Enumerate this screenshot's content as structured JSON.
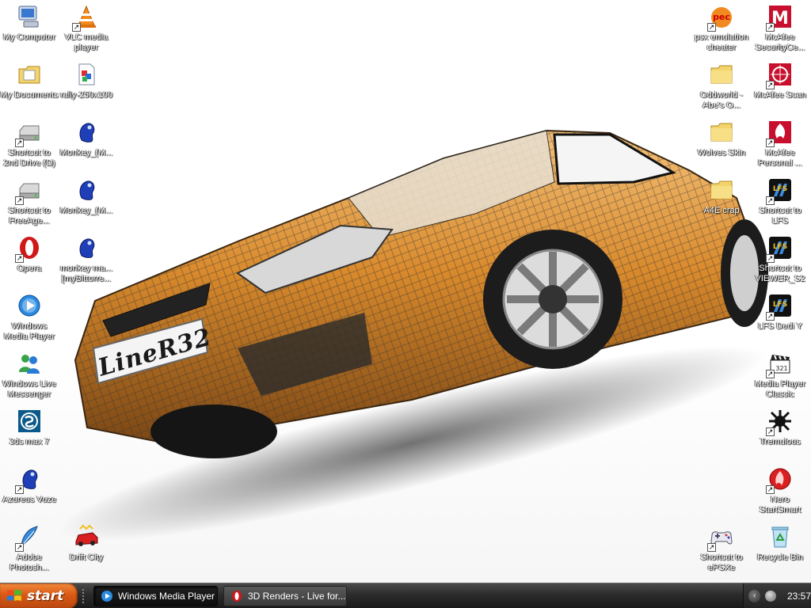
{
  "desktop": {
    "wallpaper": {
      "plate_text": "LineR32",
      "colors": {
        "car_body": "#d98a2c",
        "car_dark": "#5a3a18",
        "wire": "#3a3a3a"
      }
    },
    "icons": [
      {
        "id": "my-computer",
        "label": "My Computer",
        "icon": "computer-icon",
        "shortcut": false
      },
      {
        "id": "vlc",
        "label": "VLC media player",
        "icon": "vlc-cone-icon",
        "shortcut": true
      },
      {
        "id": "my-documents",
        "label": "My Documents",
        "icon": "documents-folder-icon",
        "shortcut": false
      },
      {
        "id": "rally",
        "label": "rally-250x100",
        "icon": "image-file-icon",
        "shortcut": false
      },
      {
        "id": "shortcut-drive-d",
        "label": "Shortcut to 2nd Drive (D)",
        "icon": "drive-icon",
        "shortcut": true
      },
      {
        "id": "monkey-1",
        "label": "Monkey_(M...",
        "icon": "azureus-frog-icon",
        "shortcut": false
      },
      {
        "id": "shortcut-freeage",
        "label": "Shortcut to FreeAge...",
        "icon": "drive-icon",
        "shortcut": true
      },
      {
        "id": "monkey-2",
        "label": "Monkey_(M...",
        "icon": "azureus-frog-icon",
        "shortcut": false
      },
      {
        "id": "opera",
        "label": "Opera",
        "icon": "opera-icon",
        "shortcut": true
      },
      {
        "id": "monkey-3",
        "label": "monkey ma... [myBittorre...",
        "icon": "azureus-frog-icon",
        "shortcut": false
      },
      {
        "id": "wmp",
        "label": "Windows Media Player",
        "icon": "media-player-icon",
        "shortcut": false
      },
      {
        "id": "wlm",
        "label": "Windows Live Messenger",
        "icon": "messenger-icon",
        "shortcut": false
      },
      {
        "id": "3dsmax",
        "label": "3ds max 7",
        "icon": "3dsmax-icon",
        "shortcut": false
      },
      {
        "id": "vuze",
        "label": "Azureus Vuze",
        "icon": "azureus-frog-icon",
        "shortcut": true
      },
      {
        "id": "photoshop",
        "label": "Adobe Photosh...",
        "icon": "photoshop-feather-icon",
        "shortcut": true
      },
      {
        "id": "drift-city",
        "label": "Drift City",
        "icon": "drift-city-car-icon",
        "shortcut": false
      },
      {
        "id": "psx-cheater",
        "label": "psx emulation cheater",
        "icon": "pec-icon",
        "shortcut": true
      },
      {
        "id": "mcafee-security",
        "label": "McAfee SecurityCe...",
        "icon": "mcafee-m-icon",
        "shortcut": true
      },
      {
        "id": "oddworld",
        "label": "Oddworld - Abe's O...",
        "icon": "folder-icon",
        "shortcut": false
      },
      {
        "id": "mcafee-scan",
        "label": "McAfee Scan",
        "icon": "mcafee-scan-icon",
        "shortcut": true
      },
      {
        "id": "wolves-skin",
        "label": "Wolves Skin",
        "icon": "folder-icon",
        "shortcut": false
      },
      {
        "id": "mcafee-personal",
        "label": "McAfee Personal ...",
        "icon": "mcafee-firewall-icon",
        "shortcut": true
      },
      {
        "id": "a4e-crap",
        "label": "A4E crap",
        "icon": "folder-icon",
        "shortcut": false
      },
      {
        "id": "shortcut-lfs",
        "label": "Shortcut to LFS",
        "icon": "lfs-icon",
        "shortcut": true
      },
      {
        "id": "shortcut-viewer",
        "label": "Shortcut to VIEWER_S2",
        "icon": "lfs-icon",
        "shortcut": true
      },
      {
        "id": "lfs-dedi",
        "label": "LFS Dedi Y",
        "icon": "lfs-icon",
        "shortcut": true
      },
      {
        "id": "mpc",
        "label": "Media Player Classic",
        "icon": "clapperboard-icon",
        "shortcut": true
      },
      {
        "id": "tremulous",
        "label": "Tremulous",
        "icon": "tremulous-alien-icon",
        "shortcut": true
      },
      {
        "id": "nero",
        "label": "Nero StartSmart",
        "icon": "nero-icon",
        "shortcut": true
      },
      {
        "id": "epsxe",
        "label": "Shortcut to ePSXe",
        "icon": "gamepad-icon",
        "shortcut": true
      },
      {
        "id": "recycle-bin",
        "label": "Recycle Bin",
        "icon": "recycle-bin-icon",
        "shortcut": false
      }
    ]
  },
  "taskbar": {
    "start_label": "start",
    "tasks": [
      {
        "label": "Windows Media Player",
        "icon": "media-player-icon",
        "active": true
      },
      {
        "label": "3D Renders - Live for...",
        "icon": "browser-icon",
        "active": false
      }
    ],
    "tray": {
      "clock": "23:57"
    }
  }
}
